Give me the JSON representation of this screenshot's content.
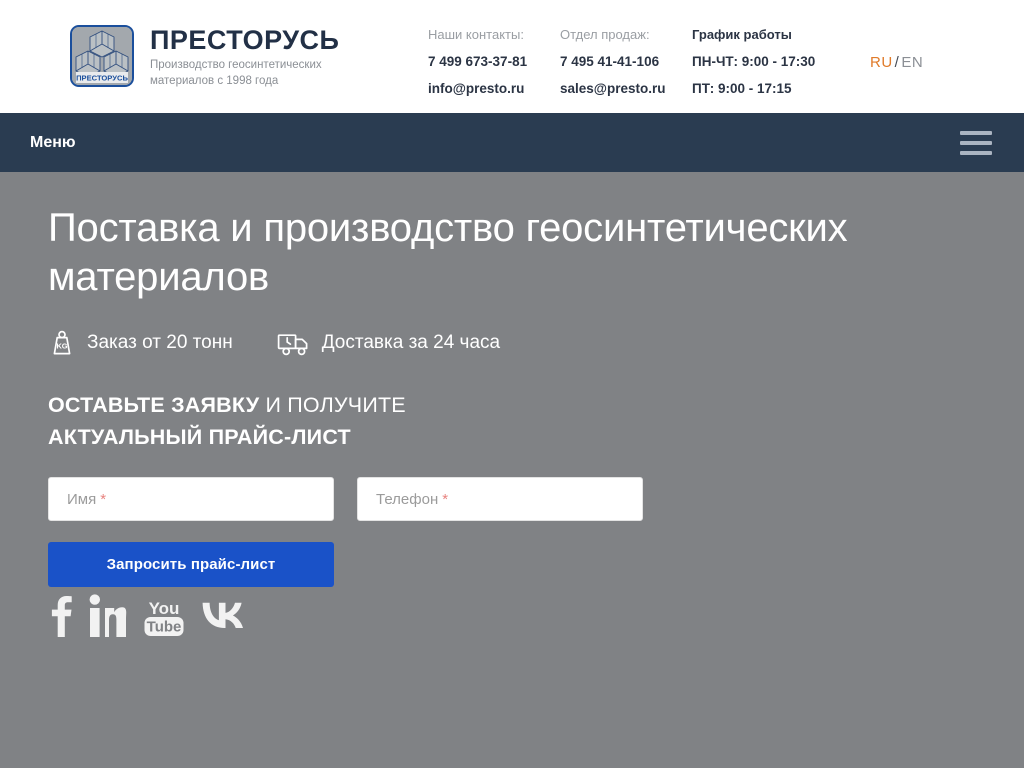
{
  "header": {
    "logo_icon": "presto-geogrid-logo-icon",
    "logo_caption": "ПРЕСТОРУСЬ",
    "brand_title": "ПРЕСТОРУСЬ",
    "brand_subtitle": "Производство геосинтетических\nматериалов с 1998 года",
    "contacts": {
      "col1": {
        "heading": "Наши контакты:",
        "phone": "7 499 673-37-81",
        "email": "info@presto.ru"
      },
      "col2": {
        "heading": "Отдел продаж:",
        "phone": "7 495 41-41-106",
        "email": "sales@presto.ru"
      },
      "col3": {
        "heading": "График работы",
        "line1": "ПН-ЧТ: 9:00 - 17:30",
        "line2": "ПТ: 9:00 - 17:15"
      }
    },
    "language": {
      "active": "RU",
      "separator": "/",
      "inactive": "EN"
    }
  },
  "navbar": {
    "menu_label": "Меню",
    "burger_icon": "hamburger-menu-icon"
  },
  "hero": {
    "title": "Поставка и производство геосинтетических материалов",
    "features": [
      {
        "icon": "weight-kg-icon",
        "label": "Заказ от 20 тонн"
      },
      {
        "icon": "delivery-truck-clock-icon",
        "label": "Доставка за 24 часа"
      }
    ],
    "form": {
      "heading_bold_1": "ОСТАВЬТЕ ЗАЯВКУ",
      "heading_light": " И ПОЛУЧИТЕ",
      "heading_bold_2": "АКТУАЛЬНЫЙ ПРАЙС-ЛИСТ",
      "name_field": {
        "value": "",
        "placeholder": "Имя",
        "required_mark": "*"
      },
      "phone_field": {
        "value": "",
        "placeholder": "Телефон",
        "required_mark": "*"
      },
      "submit_label": "Запросить прайс-лист"
    },
    "socials": [
      {
        "icon": "facebook-icon",
        "name": "Facebook"
      },
      {
        "icon": "linkedin-icon",
        "name": "LinkedIn"
      },
      {
        "icon": "youtube-icon",
        "name": "YouTube"
      },
      {
        "icon": "vk-icon",
        "name": "VK"
      }
    ]
  },
  "colors": {
    "page_bg": "#808285",
    "navbar_bg": "#2a3c51",
    "accent_blue": "#1a52c8",
    "logo_border": "#1b4f9c",
    "lang_active": "#e07b2a",
    "required_red": "#e8837f"
  }
}
